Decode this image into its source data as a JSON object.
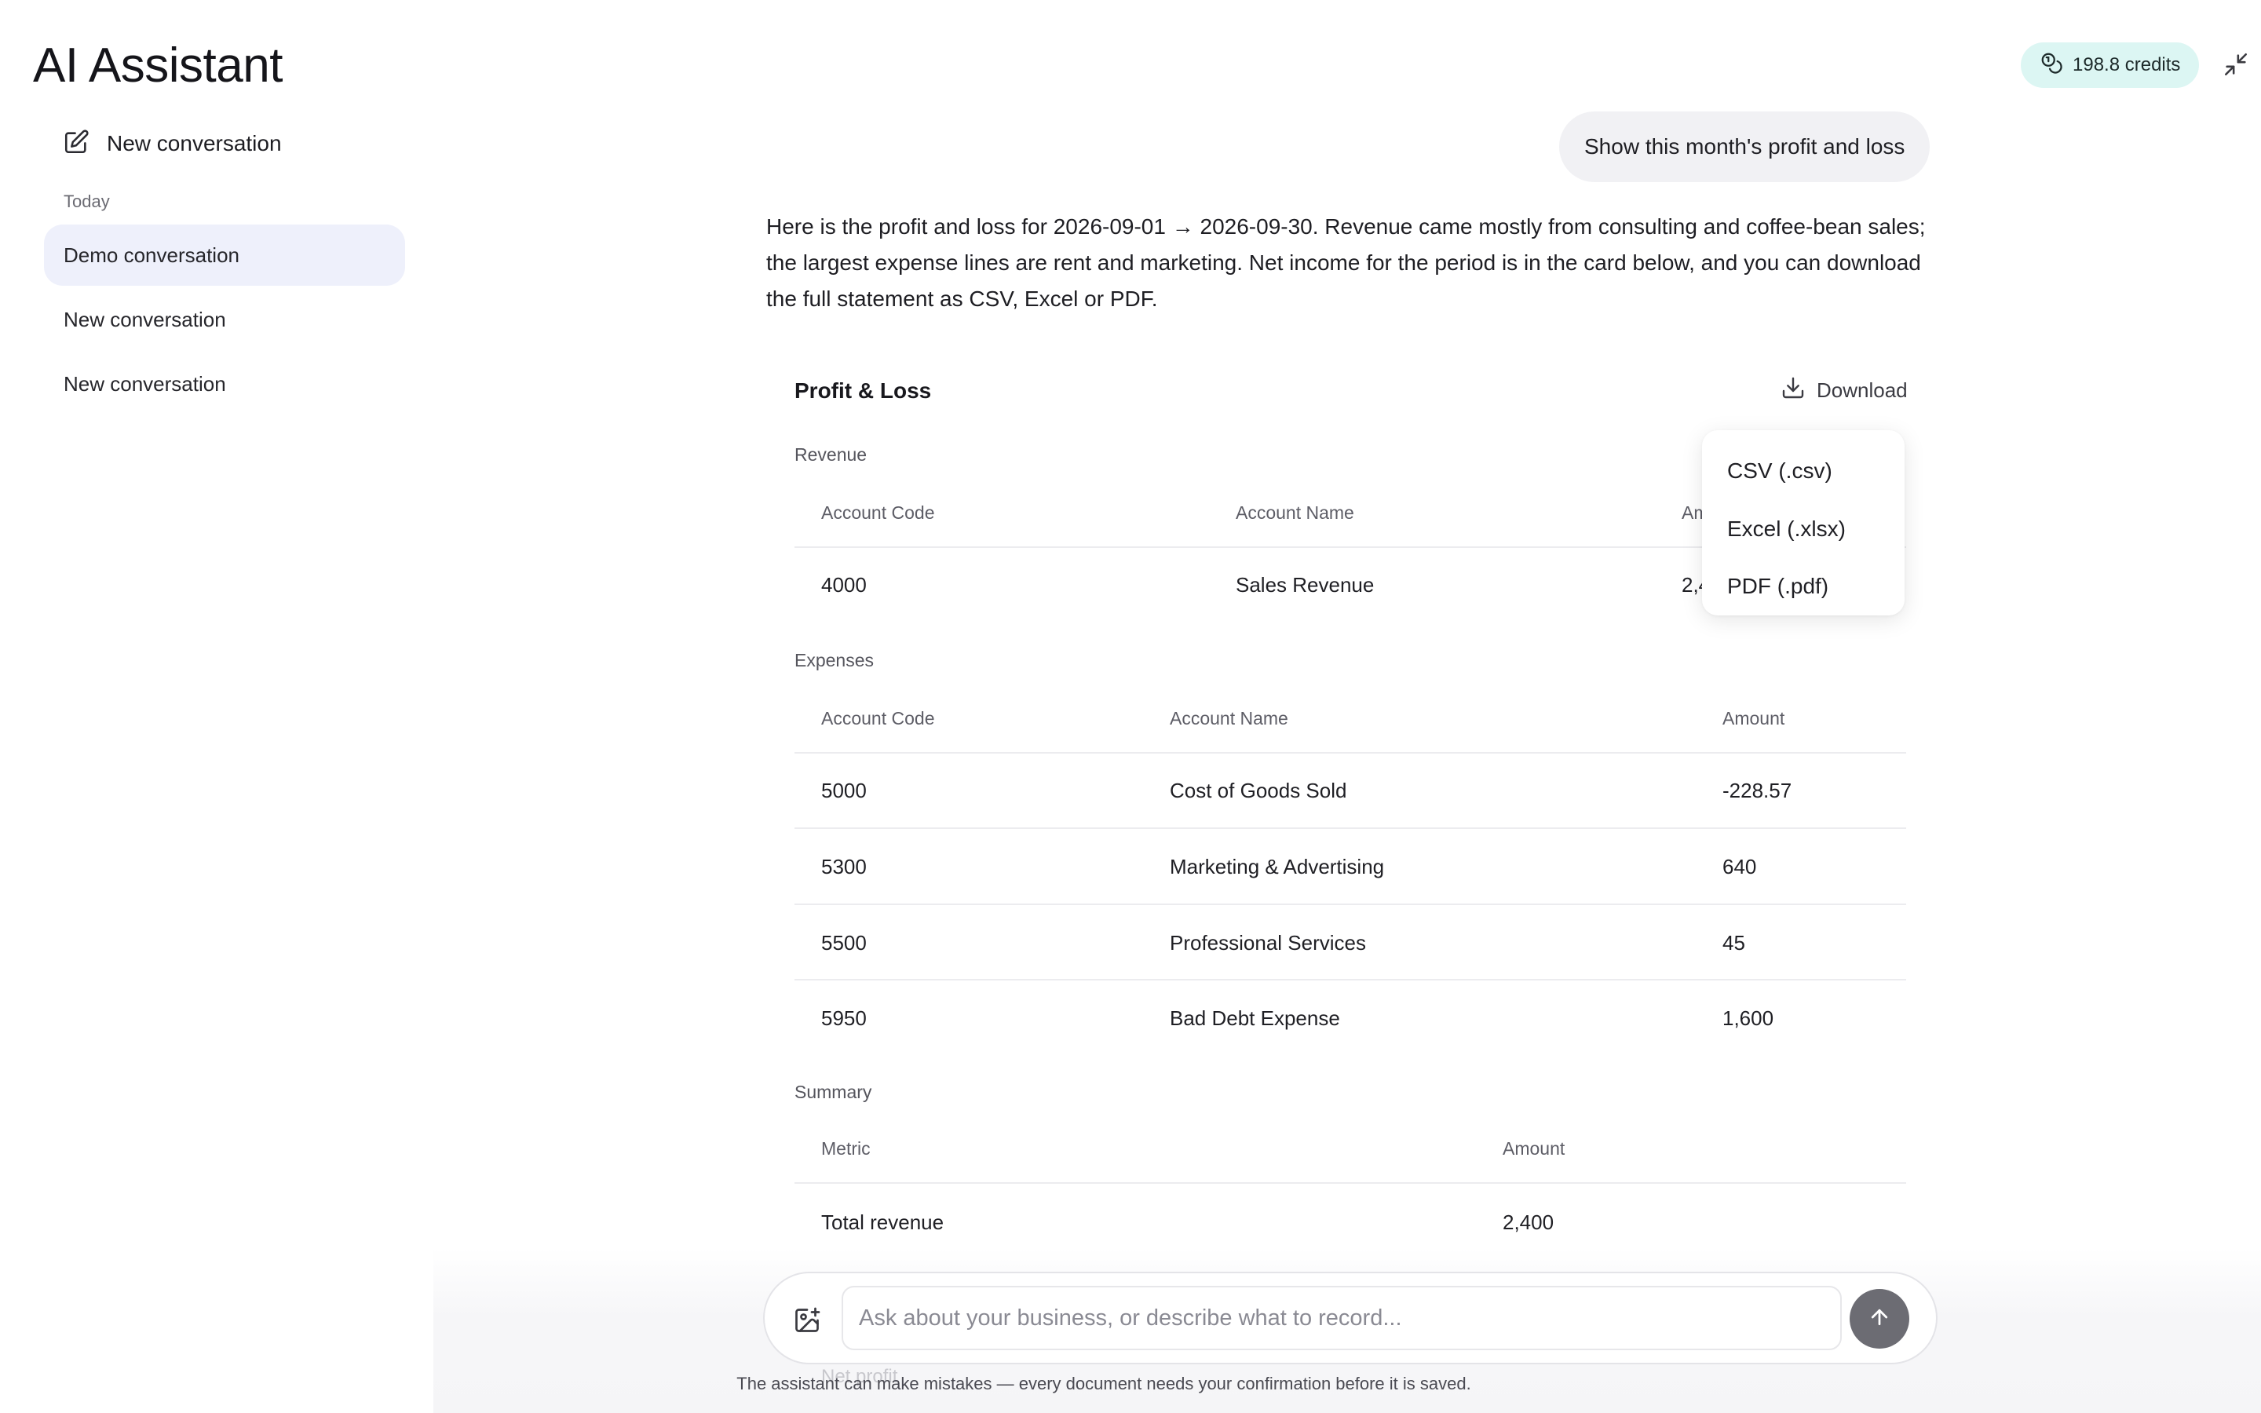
{
  "app": {
    "title": "AI Assistant"
  },
  "header": {
    "credits": "198.8 credits"
  },
  "sidebar": {
    "new_conversation": "New conversation",
    "section": "Today",
    "items": [
      {
        "label": "Demo conversation",
        "active": true
      },
      {
        "label": "New conversation",
        "active": false
      },
      {
        "label": "New conversation",
        "active": false
      }
    ]
  },
  "chat": {
    "user_message": "Show this month's profit and loss",
    "answer_lines": [
      "Here is the profit and loss for 2026-09-01 → 2026-09-30. Revenue came mostly from consulting and coffee-bean sales;",
      "the largest expense lines are rent and marketing. Net income for the period is in the card below, and you can download",
      "the full statement as CSV, Excel or PDF."
    ]
  },
  "report": {
    "title": "Profit & Loss",
    "download_label": "Download",
    "download_options": [
      "CSV (.csv)",
      "Excel (.xlsx)",
      "PDF (.pdf)"
    ],
    "revenue": {
      "label": "Revenue",
      "columns": [
        "Account Code",
        "Account Name",
        "Amount"
      ],
      "rows": [
        {
          "code": "4000",
          "name": "Sales Revenue",
          "amount": "2,400"
        }
      ]
    },
    "expenses": {
      "label": "Expenses",
      "columns": [
        "Account Code",
        "Account Name",
        "Amount"
      ],
      "rows": [
        {
          "code": "5000",
          "name": "Cost of Goods Sold",
          "amount": "-228.57"
        },
        {
          "code": "5300",
          "name": "Marketing & Advertising",
          "amount": "640"
        },
        {
          "code": "5500",
          "name": "Professional Services",
          "amount": "45"
        },
        {
          "code": "5950",
          "name": "Bad Debt Expense",
          "amount": "1,600"
        }
      ]
    },
    "summary": {
      "label": "Summary",
      "columns": [
        "Metric",
        "Amount"
      ],
      "rows": [
        {
          "metric": "Total revenue",
          "amount": "2,400"
        },
        {
          "metric": "Net profit",
          "amount": ""
        }
      ]
    }
  },
  "composer": {
    "placeholder": "Ask about your business, or describe what to record...",
    "disclaimer": "The assistant can make mistakes — every document needs your confirmation before it is saved."
  },
  "colors": {
    "active_item_bg": "#eef0fb",
    "credits_bg": "#dcf6f3",
    "send_button": "#6c6c73"
  }
}
